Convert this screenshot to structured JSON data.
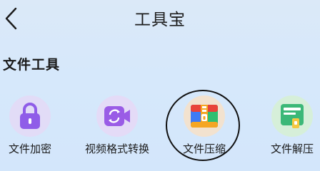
{
  "header": {
    "title": "工具宝",
    "back_icon": "chevron-left-icon"
  },
  "section": {
    "title": "文件工具"
  },
  "tools": [
    {
      "label": "文件加密",
      "icon": "lock-icon",
      "color": "#8f5de8"
    },
    {
      "label": "视频格式转换",
      "icon": "video-convert-icon",
      "color": "#9a5ce6"
    },
    {
      "label": "文件压缩",
      "icon": "archive-zip-icon",
      "color": "#f5a623"
    },
    {
      "label": "文件解压",
      "icon": "unzip-document-icon",
      "color": "#3cb878"
    }
  ],
  "annotation": {
    "highlighted_tool": "文件压缩"
  }
}
